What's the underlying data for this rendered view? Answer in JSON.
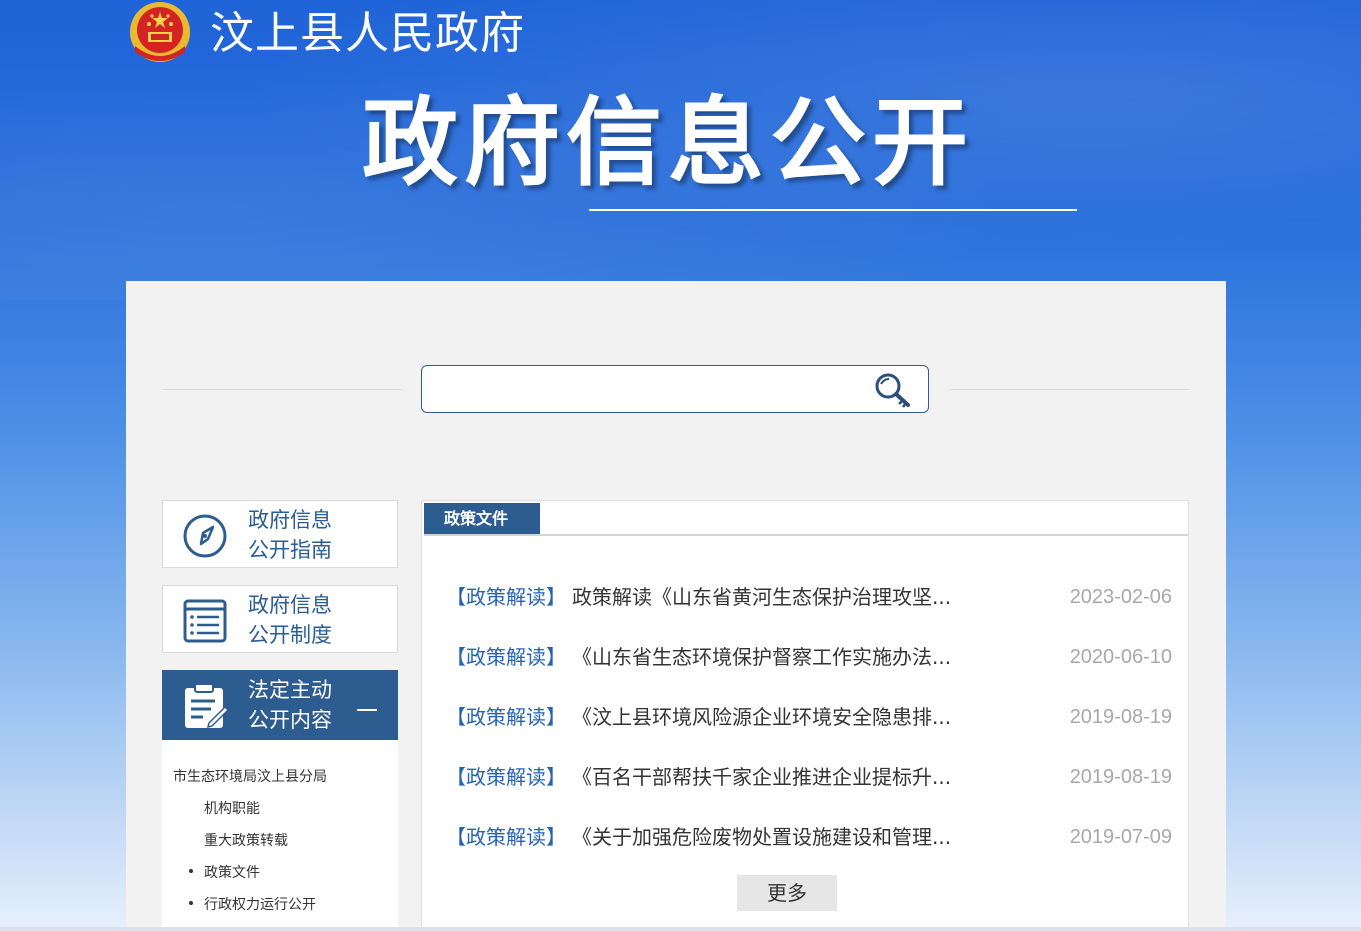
{
  "header": {
    "site_name": "汶上县人民政府",
    "page_title": "政府信息公开",
    "emblem_icon": "national-emblem-icon"
  },
  "search": {
    "placeholder": "",
    "value": "",
    "icon": "search-key-icon"
  },
  "sidebar": {
    "items": [
      {
        "label_line1": "政府信息",
        "label_line2": "公开指南",
        "icon": "compass-icon"
      },
      {
        "label_line1": "政府信息",
        "label_line2": "公开制度",
        "icon": "list-document-icon"
      },
      {
        "label_line1": "法定主动",
        "label_line2": "公开内容",
        "icon": "clipboard-edit-icon",
        "active": true
      }
    ],
    "sub_items": [
      {
        "label": "市生态环境局汶上县分局"
      },
      {
        "label": "机构职能"
      },
      {
        "label": "重大政策转载"
      },
      {
        "label": "政策文件"
      },
      {
        "label": "行政权力运行公开"
      }
    ]
  },
  "content": {
    "tab_label": "政策文件",
    "rows": [
      {
        "category": "【政策解读】",
        "title": "政策解读《山东省黄河生态保护治理攻坚...",
        "date": "2023-02-06"
      },
      {
        "category": "【政策解读】",
        "title": "《山东省生态环境保护督察工作实施办法...",
        "date": "2020-06-10"
      },
      {
        "category": "【政策解读】",
        "title": "《汶上县环境风险源企业环境安全隐患排...",
        "date": "2019-08-19"
      },
      {
        "category": "【政策解读】",
        "title": "《百名干部帮扶千家企业推进企业提标升...",
        "date": "2019-08-19"
      },
      {
        "category": "【政策解读】",
        "title": "《关于加强危险废物处置设施建设和管理...",
        "date": "2019-07-09"
      }
    ],
    "more_label": "更多"
  },
  "colors": {
    "header_blue": "#1f63d8",
    "accent_navy": "#2d5c91",
    "link_blue": "#2563b8",
    "date_gray": "#a8a8a8"
  }
}
